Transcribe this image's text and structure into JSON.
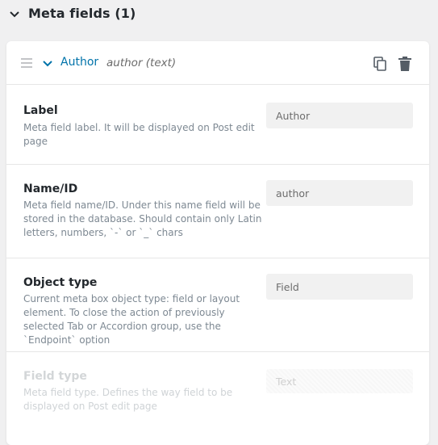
{
  "section": {
    "title": "Meta fields (1)",
    "expanded": true
  },
  "field": {
    "title": "Author",
    "subtitle": "author (text)",
    "rows": [
      {
        "label": "Label",
        "description": "Meta field label. It will be displayed on Post edit page",
        "value": "Author"
      },
      {
        "label": "Name/ID",
        "description": "Meta field name/ID. Under this name field will be stored in the database. Should contain only Latin letters, numbers, `-` or `_` chars",
        "value": "author"
      },
      {
        "label": "Object type",
        "description": "Current meta box object type: field or layout element. To close the action of previously selected Tab or Accordion group, use the `Endpoint` option",
        "value": "Field"
      },
      {
        "label": "Field type",
        "description": "Meta field type. Defines the way field to be displayed on Post edit page",
        "value": "Text",
        "disabled": true
      }
    ]
  },
  "colors": {
    "accent": "#0073aa",
    "icon": "#555d66",
    "background": "#f0f0f1",
    "card": "#ffffff"
  }
}
